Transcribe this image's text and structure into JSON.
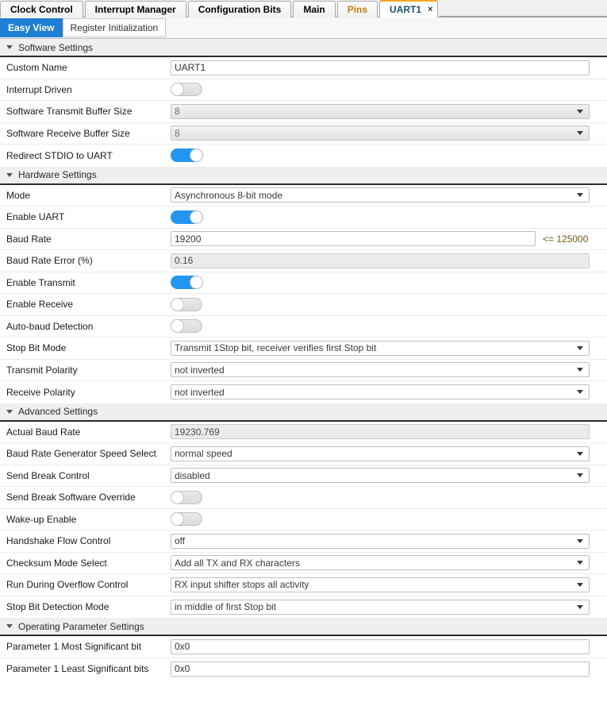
{
  "main_tabs": [
    {
      "label": "Clock Control",
      "active": false,
      "accent": false,
      "closable": false
    },
    {
      "label": "Interrupt Manager",
      "active": false,
      "accent": false,
      "closable": false
    },
    {
      "label": "Configuration Bits",
      "active": false,
      "accent": false,
      "closable": false
    },
    {
      "label": "Main",
      "active": false,
      "accent": false,
      "closable": false
    },
    {
      "label": "Pins",
      "active": false,
      "accent": true,
      "closable": false
    },
    {
      "label": "UART1",
      "active": true,
      "accent": false,
      "closable": true,
      "close_glyph": "×"
    }
  ],
  "sub_tabs": [
    {
      "label": "Easy View",
      "active": true
    },
    {
      "label": "Register Initialization",
      "active": false
    }
  ],
  "sections": [
    {
      "title": "Software Settings",
      "rows": [
        {
          "label": "Custom Name",
          "type": "text",
          "value": "UART1",
          "readonly": false,
          "width": "full"
        },
        {
          "label": "Interrupt Driven",
          "type": "toggle",
          "value": "off"
        },
        {
          "label": "Software Transmit Buffer Size",
          "type": "dropdown",
          "value": "8",
          "disabled": true
        },
        {
          "label": "Software Receive Buffer Size",
          "type": "dropdown",
          "value": "8",
          "disabled": true
        },
        {
          "label": "Redirect STDIO to UART",
          "type": "toggle",
          "value": "on"
        }
      ]
    },
    {
      "title": "Hardware Settings",
      "rows": [
        {
          "label": "Mode",
          "type": "dropdown",
          "value": "Asynchronous 8-bit mode",
          "disabled": false
        },
        {
          "label": "Enable UART",
          "type": "toggle",
          "value": "on"
        },
        {
          "label": "Baud Rate",
          "type": "text",
          "value": "19200",
          "readonly": false,
          "width": "narrow",
          "suffix": "<= 125000"
        },
        {
          "label": "Baud Rate Error (%)",
          "type": "text",
          "value": "0.16",
          "readonly": true,
          "width": "full"
        },
        {
          "label": "Enable Transmit",
          "type": "toggle",
          "value": "on"
        },
        {
          "label": "Enable Receive",
          "type": "toggle",
          "value": "off"
        },
        {
          "label": "Auto-baud Detection",
          "type": "toggle",
          "value": "off"
        },
        {
          "label": "Stop Bit Mode",
          "type": "dropdown",
          "value": "Transmit 1Stop bit, receiver verifies first Stop bit",
          "disabled": false
        },
        {
          "label": "Transmit Polarity",
          "type": "dropdown",
          "value": "not inverted",
          "disabled": false
        },
        {
          "label": "Receive Polarity",
          "type": "dropdown",
          "value": "not inverted",
          "disabled": false
        }
      ]
    },
    {
      "title": "Advanced Settings",
      "rows": [
        {
          "label": "Actual Baud Rate",
          "type": "text",
          "value": "19230.769",
          "readonly": true,
          "width": "full"
        },
        {
          "label": "Baud Rate Generator Speed Select",
          "type": "dropdown",
          "value": "normal speed",
          "disabled": false
        },
        {
          "label": "Send Break Control",
          "type": "dropdown",
          "value": "disabled",
          "disabled": false
        },
        {
          "label": "Send Break Software Override",
          "type": "toggle",
          "value": "off"
        },
        {
          "label": "Wake-up Enable",
          "type": "toggle",
          "value": "off"
        },
        {
          "label": "Handshake Flow Control",
          "type": "dropdown",
          "value": "off",
          "disabled": false
        },
        {
          "label": "Checksum Mode Select",
          "type": "dropdown",
          "value": "Add all TX and RX characters",
          "disabled": false
        },
        {
          "label": "Run During Overflow Control",
          "type": "dropdown",
          "value": "RX input shifter stops all activity",
          "disabled": false
        },
        {
          "label": "Stop Bit Detection Mode",
          "type": "dropdown",
          "value": "in middle of first Stop bit",
          "disabled": false
        }
      ]
    },
    {
      "title": "Operating Parameter Settings",
      "rows": [
        {
          "label": "Parameter 1 Most Significant bit",
          "type": "text",
          "value": "0x0",
          "readonly": false,
          "width": "full"
        },
        {
          "label": "Parameter 1 Least Significant bits",
          "type": "text",
          "value": "0x0",
          "readonly": false,
          "width": "full"
        }
      ]
    }
  ],
  "colors": {
    "accent_blue": "#1f7fd4",
    "toggle_on": "#2196f3",
    "tab_active_top": "#f5a623",
    "tab_accent_text": "#c67a10",
    "suffix_text": "#6b5a14"
  }
}
